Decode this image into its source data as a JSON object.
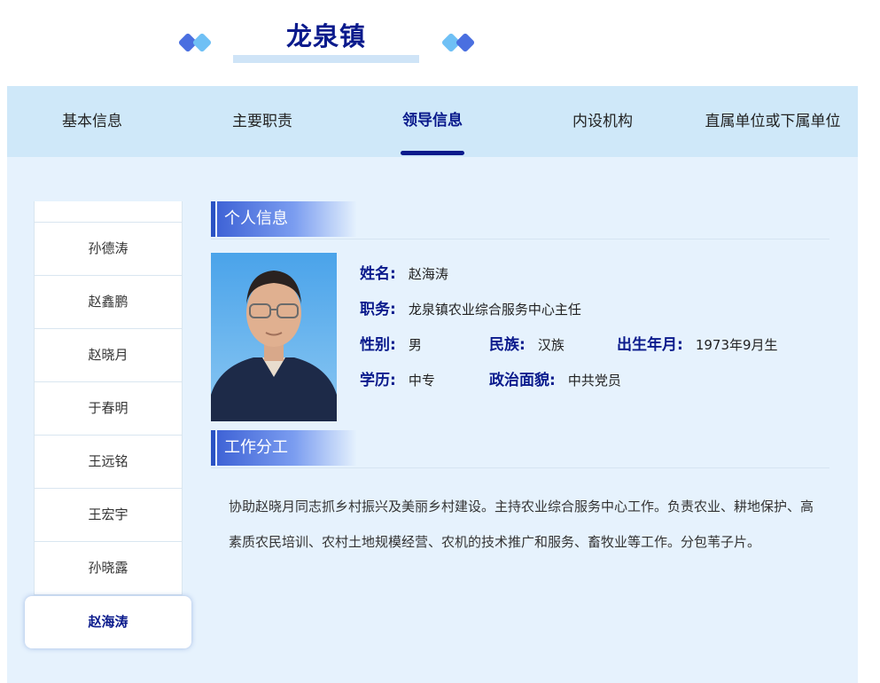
{
  "page": {
    "title": "龙泉镇"
  },
  "nav": {
    "tabs": [
      {
        "label": "基本信息"
      },
      {
        "label": "主要职责"
      },
      {
        "label": "领导信息"
      },
      {
        "label": "内设机构"
      },
      {
        "label": "直属单位或下属单位"
      }
    ],
    "active_index": 2
  },
  "sidebar": {
    "items": [
      {
        "name": "孙德涛"
      },
      {
        "name": "赵鑫鹏"
      },
      {
        "name": "赵晓月"
      },
      {
        "name": "于春明"
      },
      {
        "name": "王远铭"
      },
      {
        "name": "王宏宇"
      },
      {
        "name": "孙晓露"
      },
      {
        "name": "赵海涛"
      }
    ],
    "active_index": 7
  },
  "personal": {
    "section_title": "个人信息",
    "name_label": "姓名:",
    "name": "赵海涛",
    "position_label": "职务:",
    "position": "龙泉镇农业综合服务中心主任",
    "gender_label": "性别:",
    "gender": "男",
    "ethnicity_label": "民族:",
    "ethnicity": "汉族",
    "birth_label": "出生年月:",
    "birth": "1973年9月生",
    "education_label": "学历:",
    "education": "中专",
    "political_label": "政治面貌:",
    "political": "中共党员"
  },
  "work": {
    "section_title": "工作分工",
    "text": "协助赵晓月同志抓乡村振兴及美丽乡村建设。主持农业综合服务中心工作。负责农业、耕地保护、高素质农民培训、农村土地规模经营、农机的技术推广和服务、畜牧业等工作。分包苇子片。"
  },
  "colors": {
    "brand": "#0a1a8c",
    "nav_bg": "#cfe8f9",
    "content_bg": "#e6f2fd",
    "section_accent": "#2a52c4"
  }
}
